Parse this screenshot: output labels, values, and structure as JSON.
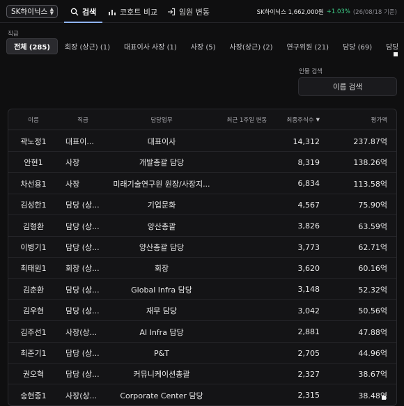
{
  "topbar": {
    "stock_select": "SK하이닉스",
    "tabs": [
      {
        "label": "검색",
        "icon": "search-icon"
      },
      {
        "label": "코호트 비교",
        "icon": "bar-chart-icon"
      },
      {
        "label": "임원 변동",
        "icon": "login-arrow-icon"
      }
    ],
    "ticker": {
      "name_price": "SK하이닉스 1,662,000원",
      "change": "+1.03%",
      "date": "(26/08/18 기준)"
    }
  },
  "filter": {
    "label": "직급",
    "chips": [
      "전체 (285)",
      "회장 (상근) (1)",
      "대표이사 사장 (1)",
      "사장 (5)",
      "사장(상근) (2)",
      "연구위원 (21)",
      "담당 (69)",
      "담당 (상"
    ]
  },
  "name_search": {
    "label": "인물 검색",
    "button": "이름 검색"
  },
  "table": {
    "headers": [
      "이름",
      "직급",
      "담당업무",
      "최근 1주일 변동",
      "최종주식수",
      "평가액"
    ],
    "sort_indicator": "▼",
    "rows": [
      {
        "name": "곽노정1",
        "position": "대표이...",
        "duty": "대표이사",
        "change": "",
        "shares": "14,312",
        "value": "237.87억"
      },
      {
        "name": "안현1",
        "position": "사장",
        "duty": "개발총괄 담당",
        "change": "",
        "shares": "8,319",
        "value": "138.26억"
      },
      {
        "name": "차선용1",
        "position": "사장",
        "duty": "미래기술연구원 원장/사장지...",
        "change": "",
        "shares": "6,834",
        "value": "113.58억"
      },
      {
        "name": "김성한1",
        "position": "담당 (상...",
        "duty": "기업문화",
        "change": "",
        "shares": "4,567",
        "value": "75.90억"
      },
      {
        "name": "김형환",
        "position": "담당 (상...",
        "duty": "양산총괄",
        "change": "",
        "shares": "3,826",
        "value": "63.59억"
      },
      {
        "name": "이병기1",
        "position": "담당 (상...",
        "duty": "양산총괄 담당",
        "change": "",
        "shares": "3,773",
        "value": "62.71억"
      },
      {
        "name": "최태원1",
        "position": "회장 (상...",
        "duty": "회장",
        "change": "",
        "shares": "3,620",
        "value": "60.16억"
      },
      {
        "name": "김춘환",
        "position": "담당 (상...",
        "duty": "Global Infra 담당",
        "change": "",
        "shares": "3,148",
        "value": "52.32억"
      },
      {
        "name": "김우현",
        "position": "담당 (상...",
        "duty": "재무 담당",
        "change": "",
        "shares": "3,042",
        "value": "50.56억"
      },
      {
        "name": "김주선1",
        "position": "사장(상...",
        "duty": "AI Infra 담당",
        "change": "",
        "shares": "2,881",
        "value": "47.88억"
      },
      {
        "name": "최준기1",
        "position": "담당 (상...",
        "duty": "P&T",
        "change": "",
        "shares": "2,705",
        "value": "44.96억"
      },
      {
        "name": "권오혁",
        "position": "담당 (상...",
        "duty": "커뮤니케이션총괄",
        "change": "",
        "shares": "2,327",
        "value": "38.67억"
      },
      {
        "name": "송현종1",
        "position": "사장(상...",
        "duty": "Corporate Center 담당",
        "change": "",
        "shares": "2,315",
        "value": "38.48억"
      }
    ]
  },
  "colors": {
    "accent": "#8fb3ff",
    "positive": "#3fd28a",
    "background": "#0f0f10"
  }
}
